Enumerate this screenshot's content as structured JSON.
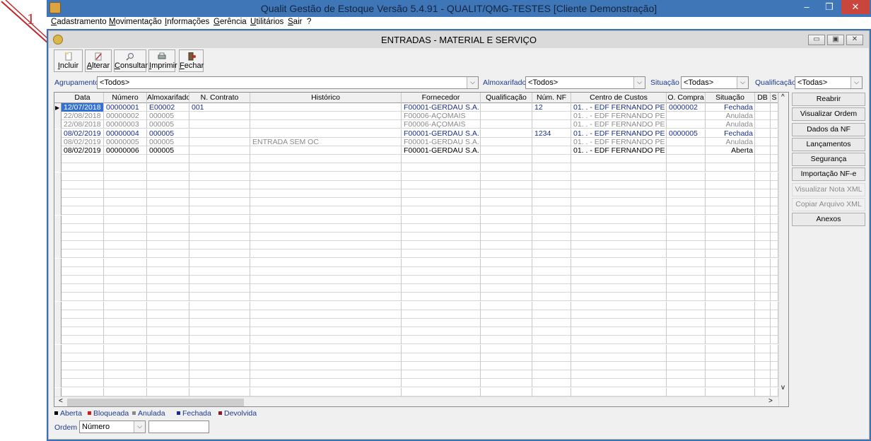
{
  "app": {
    "title": "Qualit Gestão de Estoque Versão 5.4.91 - QUALIT/QMG-TESTES [Cliente Demonstração]",
    "menu": [
      "Cadastramento",
      "Movimentação",
      "Informações",
      "Gerência",
      "Utilitários",
      "Sair",
      "?"
    ]
  },
  "annotation": {
    "number": "1"
  },
  "window": {
    "title": "ENTRADAS - MATERIAL E SERVIÇO"
  },
  "toolbar": [
    {
      "label": "Incluir",
      "icon": "new-document-icon"
    },
    {
      "label": "Alterar",
      "icon": "edit-icon"
    },
    {
      "label": "Consultar",
      "icon": "search-icon"
    },
    {
      "label": "Imprimir",
      "icon": "printer-icon"
    },
    {
      "label": "Fechar",
      "icon": "exit-door-icon"
    }
  ],
  "filters": {
    "agrupamento": {
      "label": "Agrupamento",
      "value": "<Todos>"
    },
    "almoxarifado": {
      "label": "Almoxarifado",
      "value": "<Todos>"
    },
    "situacao": {
      "label": "Situação",
      "value": "<Todas>"
    },
    "qualificacao": {
      "label": "Qualificação",
      "value": "<Todas>"
    }
  },
  "grid": {
    "columns": [
      "Data",
      "Número",
      "Almoxarifado",
      "N. Contrato",
      "Histórico",
      "Fornecedor",
      "Qualificação",
      "Núm. NF",
      "Centro de Custos",
      "O. Compra",
      "Situação",
      "DB",
      "S"
    ],
    "rows": [
      {
        "data": "12/07/2018",
        "numero": "00000001",
        "almox": "E00002",
        "contrato": "001",
        "historico": "",
        "fornecedor": "F00001-GERDAU S.A.",
        "qualif": "",
        "nf": "12",
        "cc": "01.  .    - EDF FERNANDO PE",
        "oc": "0000002",
        "situacao": "Fechada",
        "color": "#1a2f8a",
        "selected": true
      },
      {
        "data": "22/08/2018",
        "numero": "00000002",
        "almox": "000005",
        "contrato": "",
        "historico": "",
        "fornecedor": "F00006-AÇOMAIS",
        "qualif": "",
        "nf": "",
        "cc": "01.  .    - EDF FERNANDO PE",
        "oc": "",
        "situacao": "Anulada",
        "color": "#8a8a8a",
        "selected": false
      },
      {
        "data": "22/08/2018",
        "numero": "00000003",
        "almox": "000005",
        "contrato": "",
        "historico": "",
        "fornecedor": "F00006-AÇOMAIS",
        "qualif": "",
        "nf": "",
        "cc": "01.  .    - EDF FERNANDO PE",
        "oc": "",
        "situacao": "Anulada",
        "color": "#8a8a8a",
        "selected": false
      },
      {
        "data": "08/02/2019",
        "numero": "00000004",
        "almox": "000005",
        "contrato": "",
        "historico": "",
        "fornecedor": "F00001-GERDAU S.A.",
        "qualif": "",
        "nf": "1234",
        "cc": "01.  .    - EDF FERNANDO PE",
        "oc": "0000005",
        "situacao": "Fechada",
        "color": "#1a2f8a",
        "selected": false
      },
      {
        "data": "08/02/2019",
        "numero": "00000005",
        "almox": "000005",
        "contrato": "",
        "historico": "ENTRADA SEM OC",
        "fornecedor": "F00001-GERDAU S.A.",
        "qualif": "",
        "nf": "",
        "cc": "01.  .    - EDF FERNANDO PE",
        "oc": "",
        "situacao": "Anulada",
        "color": "#8a8a8a",
        "selected": false
      },
      {
        "data": "08/02/2019",
        "numero": "00000006",
        "almox": "000005",
        "contrato": "",
        "historico": "",
        "fornecedor": "F00001-GERDAU S.A.",
        "qualif": "",
        "nf": "",
        "cc": "01.  .    - EDF FERNANDO PE",
        "oc": "",
        "situacao": "Aberta",
        "color": "#000000",
        "selected": false
      }
    ]
  },
  "side_buttons": [
    {
      "label": "Reabrir",
      "enabled": true
    },
    {
      "label": "Visualizar Ordem",
      "enabled": true
    },
    {
      "label": "Dados da NF",
      "enabled": true
    },
    {
      "label": "Lançamentos",
      "enabled": true
    },
    {
      "label": "Segurança",
      "enabled": true
    },
    {
      "label": "Importação NF-e",
      "enabled": true
    },
    {
      "label": "Visualizar Nota XML",
      "enabled": false
    },
    {
      "label": "Copiar Arquivo XML",
      "enabled": false
    },
    {
      "label": "Anexos",
      "enabled": true
    }
  ],
  "legend": [
    {
      "label": "Aberta",
      "color": "#000000"
    },
    {
      "label": "Bloqueada",
      "color": "#d11a1a"
    },
    {
      "label": "Anulada",
      "color": "#8a8a8a"
    },
    {
      "label": "Fechada",
      "color": "#1a2f8a"
    },
    {
      "label": "Devolvida",
      "color": "#8a1a2a"
    }
  ],
  "order": {
    "label": "Ordem",
    "value": "Número",
    "search_value": ""
  }
}
